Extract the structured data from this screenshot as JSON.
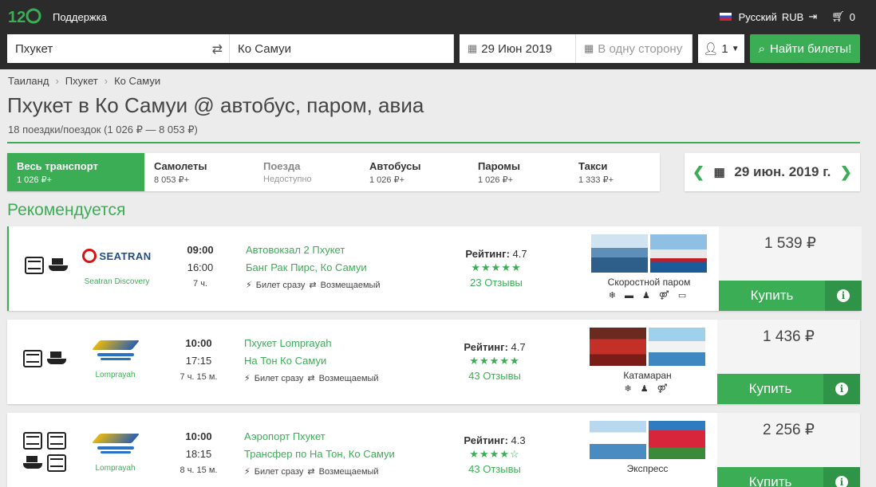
{
  "header": {
    "logo_text": "12Go",
    "support": "Поддержка",
    "language": "Русский",
    "currency": "RUB",
    "cart_count": "0"
  },
  "search": {
    "from": "Пхукет",
    "to": "Ко Самуи",
    "date": "29 Июн 2019",
    "return_placeholder": "В одну сторону",
    "passengers": "1",
    "find_label": "Найти билеты!"
  },
  "breadcrumb": [
    "Таиланд",
    "Пхукет",
    "Ко Самуи"
  ],
  "page": {
    "title": "Пхукет в Ко Самуи @ автобус, паром, авиа",
    "subtitle": "18 поездки/поездок (1 026 ₽ — 8 053 ₽)",
    "recommended": "Рекомендуется"
  },
  "tabs": [
    {
      "label": "Весь транспорт",
      "sub": "1 026 ₽+"
    },
    {
      "label": "Самолеты",
      "sub": "8 053 ₽+"
    },
    {
      "label": "Поезда",
      "sub": "Недоступно"
    },
    {
      "label": "Автобусы",
      "sub": "1 026 ₽+"
    },
    {
      "label": "Паромы",
      "sub": "1 026 ₽+"
    },
    {
      "label": "Такси",
      "sub": "1 333 ₽+"
    }
  ],
  "date_nav": {
    "date": "29 июн. 2019 г."
  },
  "results": [
    {
      "company": "Seatran Discovery",
      "logo_text": "SEATRAN",
      "dep": "09:00",
      "arr": "16:00",
      "dur": "7 ч.",
      "from": "Автовокзал 2 Пхукет",
      "to": "Банг Рак Пирс, Ко Самуи",
      "instant": "Билет сразу",
      "refund": "Возмещаемый",
      "rating_label": "Рейтинг:",
      "rating": "4.7",
      "stars": "★★★★★",
      "reviews": "23 Отзывы",
      "vehicle": "Скоростной паром",
      "amenities": "❄ ▬ ♟ ⚤ ▭",
      "price": "1 539 ₽",
      "buy": "Купить"
    },
    {
      "company": "Lomprayah",
      "dep": "10:00",
      "arr": "17:15",
      "dur": "7 ч. 15 м.",
      "from": "Пхукет Lomprayah",
      "to": "На Тон Ко Самуи",
      "instant": "Билет сразу",
      "refund": "Возмещаемый",
      "rating_label": "Рейтинг:",
      "rating": "4.7",
      "stars": "★★★★★",
      "reviews": "43 Отзывы",
      "vehicle": "Катамаран",
      "amenities": "❄ ♟ ⚤",
      "price": "1 436 ₽",
      "buy": "Купить"
    },
    {
      "company": "Lomprayah",
      "dep": "10:00",
      "arr": "18:15",
      "dur": "8 ч. 15 м.",
      "from": "Аэропорт Пхукет",
      "to": "Трансфер по На Тон, Ко Самуи",
      "instant": "Билет сразу",
      "refund": "Возмещаемый",
      "rating_label": "Рейтинг:",
      "rating": "4.3",
      "stars": "★★★★☆",
      "reviews": "43 Отзывы",
      "vehicle": "Экспресс",
      "price": "2 256 ₽",
      "buy": "Купить"
    }
  ],
  "colors": {
    "accent": "#3bae55",
    "header_bg": "#2b2b2b"
  }
}
